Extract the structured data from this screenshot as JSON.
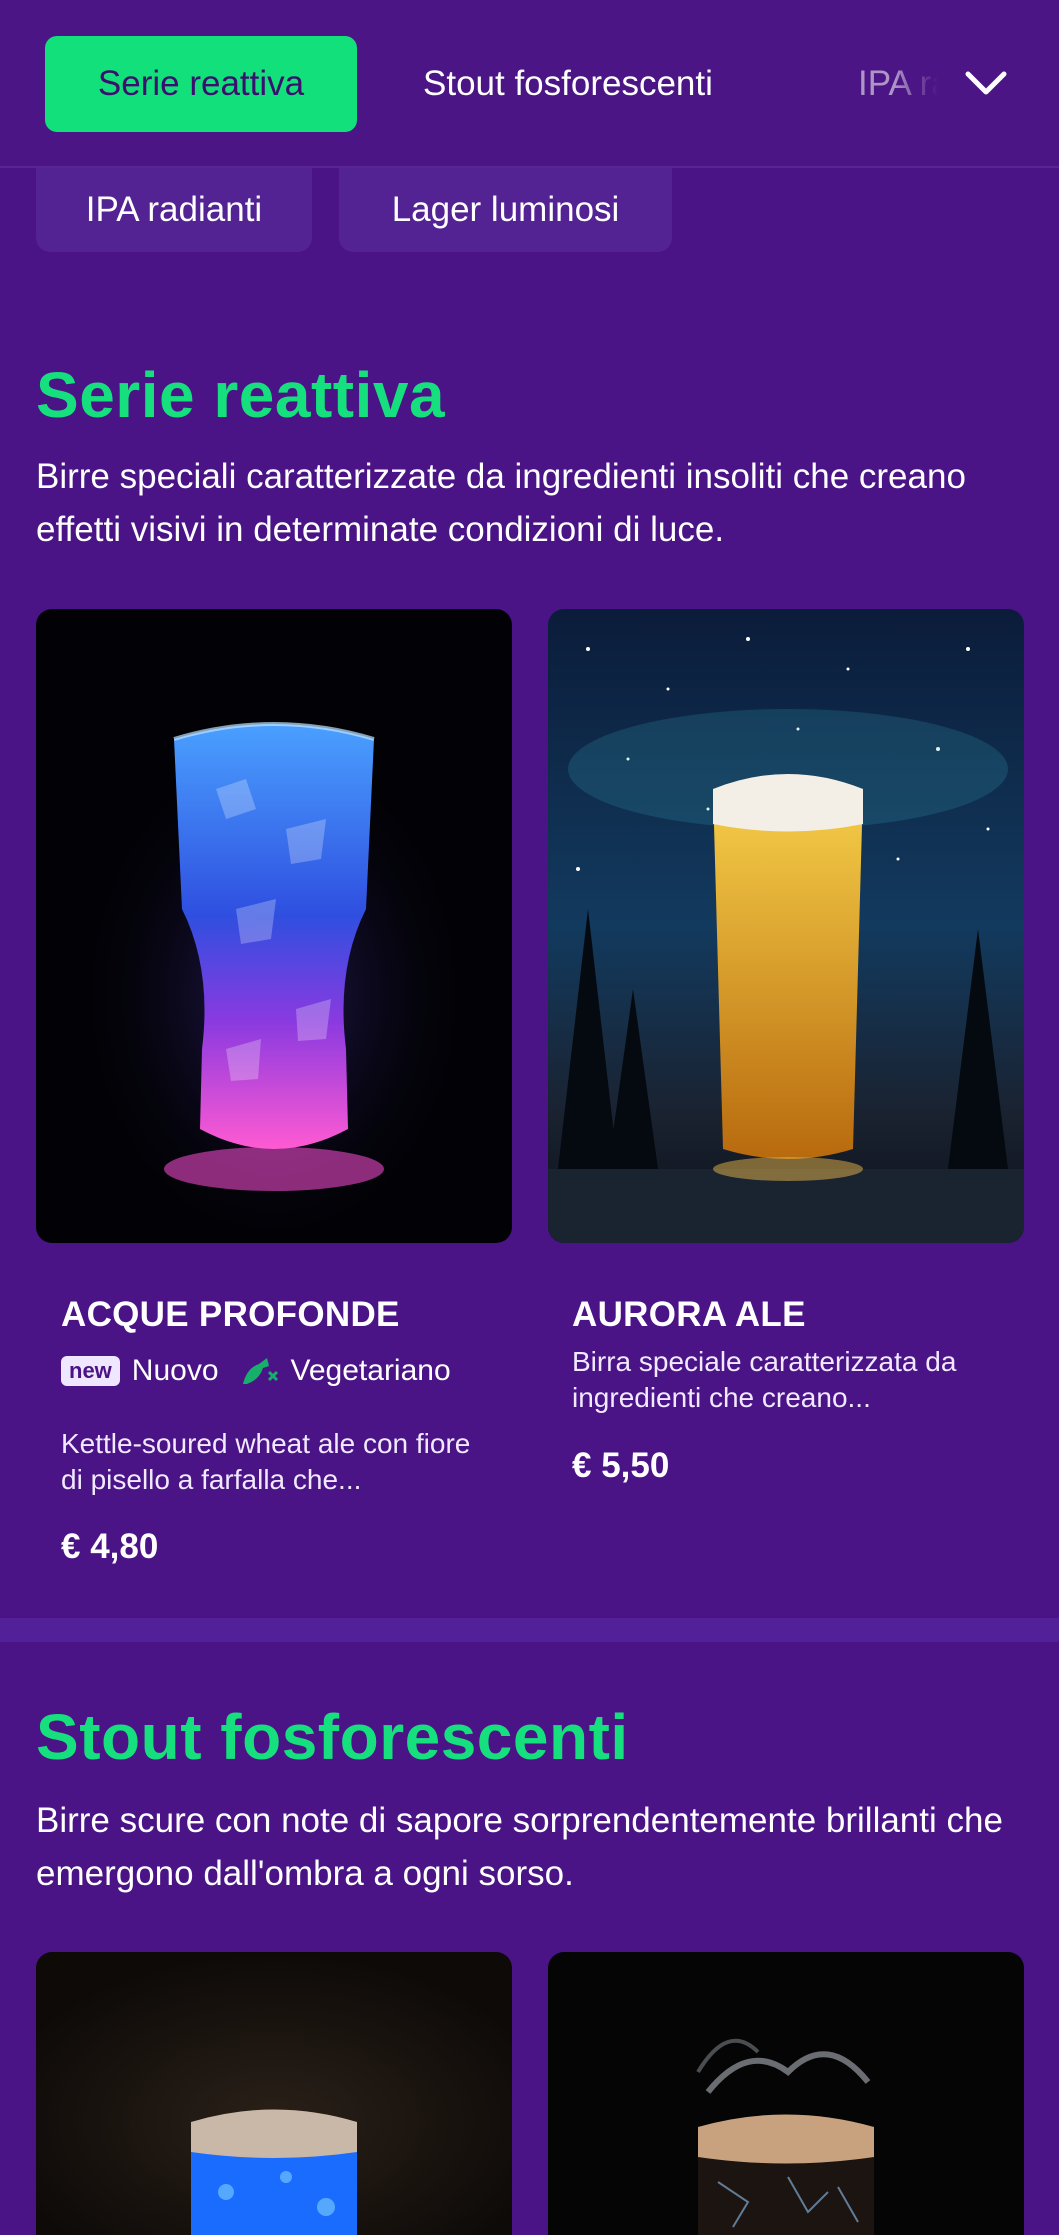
{
  "nav": {
    "tabs": [
      {
        "label": "Serie reattiva"
      },
      {
        "label": "Stout fosforescenti"
      },
      {
        "label": "IPA radianti"
      }
    ],
    "chips": [
      {
        "label": "IPA radianti"
      },
      {
        "label": "Lager luminosi"
      }
    ],
    "expand_icon": "chevron-down-icon"
  },
  "sections": [
    {
      "title": "Serie reattiva",
      "description": "Birre speciali caratterizzate da ingredienti insoliti che creano effetti visivi in determinate condizioni di luce.",
      "products": [
        {
          "name": "ACQUE PROFONDE",
          "tags": {
            "new_badge": "new",
            "new_label": "Nuovo",
            "veg_label": "Vegetariano"
          },
          "description": "Kettle-soured wheat ale con fiore di pisello a farfalla che...",
          "price": "€ 4,80"
        },
        {
          "name": "AURORA ALE",
          "description": "Birra speciale caratterizzata da ingredienti che creano...",
          "price": "€ 5,50"
        }
      ]
    },
    {
      "title": "Stout fosforescenti",
      "description": "Birre scure con note di sapore sorprendentemente brillanti che emergono dall'ombra a ogni sorso."
    }
  ],
  "colors": {
    "background": "#4a1486",
    "accent": "#12e07a",
    "section_title": "#16e07e"
  }
}
